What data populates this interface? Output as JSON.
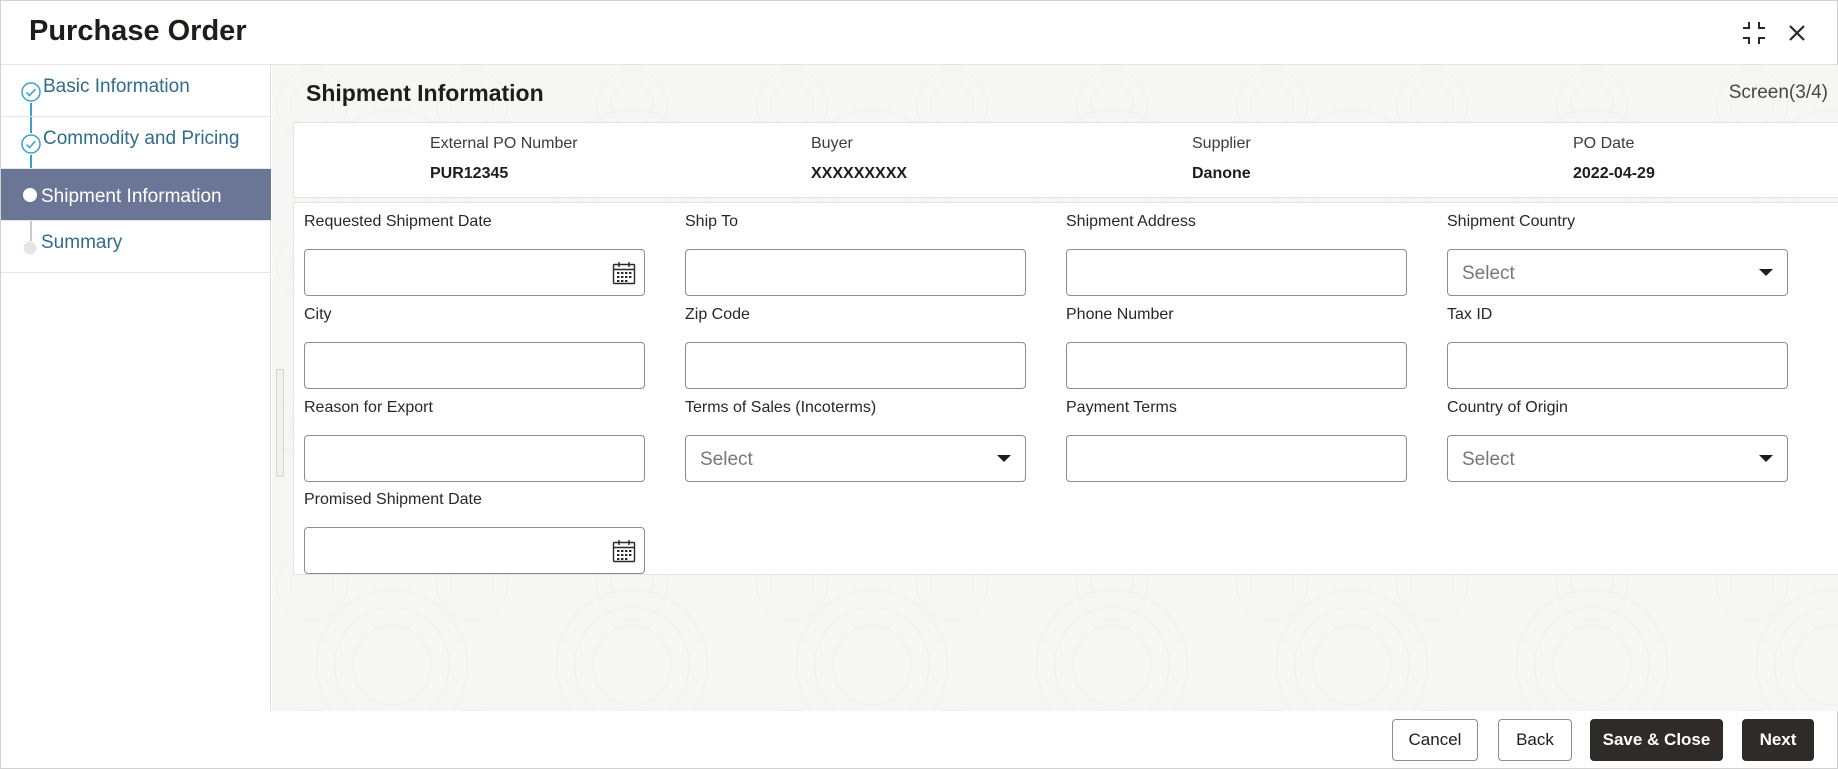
{
  "window": {
    "title": "Purchase Order"
  },
  "steps": [
    {
      "label": "Basic Information",
      "state": "complete"
    },
    {
      "label": "Commodity and Pricing",
      "state": "complete"
    },
    {
      "label": "Shipment Information",
      "state": "active"
    },
    {
      "label": "Summary",
      "state": "pending"
    }
  ],
  "main": {
    "section_title": "Shipment Information",
    "screen_indicator": "Screen(3/4)"
  },
  "summary": [
    {
      "label": "External PO Number",
      "value": "PUR12345"
    },
    {
      "label": "Buyer",
      "value": "XXXXXXXXX"
    },
    {
      "label": "Supplier",
      "value": "Danone"
    },
    {
      "label": "PO Date",
      "value": "2022-04-29"
    }
  ],
  "fields": {
    "requested_shipment_date": {
      "label": "Requested Shipment Date",
      "value": ""
    },
    "ship_to": {
      "label": "Ship To",
      "value": ""
    },
    "shipment_address": {
      "label": "Shipment Address",
      "value": ""
    },
    "shipment_country": {
      "label": "Shipment Country",
      "placeholder": "Select"
    },
    "city": {
      "label": "City",
      "value": ""
    },
    "zip_code": {
      "label": "Zip Code",
      "value": ""
    },
    "phone_number": {
      "label": "Phone Number",
      "value": ""
    },
    "tax_id": {
      "label": "Tax ID",
      "value": ""
    },
    "reason_for_export": {
      "label": "Reason for Export",
      "value": ""
    },
    "terms_of_sales": {
      "label": "Terms of Sales (Incoterms)",
      "placeholder": "Select"
    },
    "payment_terms": {
      "label": "Payment Terms",
      "value": ""
    },
    "country_of_origin": {
      "label": "Country of Origin",
      "placeholder": "Select"
    },
    "promised_shipment_date": {
      "label": "Promised Shipment Date",
      "value": ""
    }
  },
  "footer": {
    "cancel_label": "Cancel",
    "back_label": "Back",
    "save_close_label": "Save & Close",
    "next_label": "Next"
  },
  "colors": {
    "active_step_bg": "#6b7697",
    "step_link": "#2f6d8a",
    "connector": "#3aa1c8",
    "primary_button": "#2f2b28"
  }
}
